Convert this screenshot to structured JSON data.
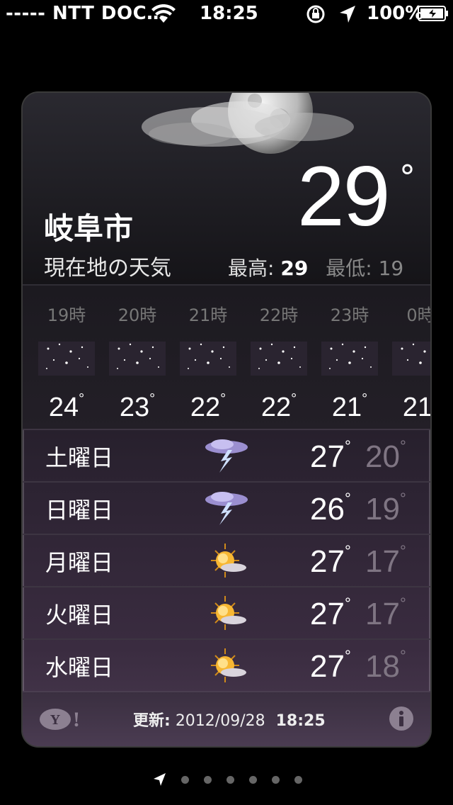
{
  "status_bar": {
    "carrier": "----- NTT DOC…",
    "time": "18:25",
    "battery": "100%"
  },
  "current": {
    "city": "岐阜市",
    "location_label": "現在地の天気",
    "temp": "29",
    "degree": "°",
    "hi_label": "最高:",
    "hi_value": "29",
    "lo_label": "最低:",
    "lo_value": "19",
    "icon": "night-cloudy-moon-icon"
  },
  "hourly": [
    {
      "time": "19時",
      "temp": "24",
      "icon": "clear-night-icon"
    },
    {
      "time": "20時",
      "temp": "23",
      "icon": "clear-night-icon"
    },
    {
      "time": "21時",
      "temp": "22",
      "icon": "clear-night-icon"
    },
    {
      "time": "22時",
      "temp": "22",
      "icon": "clear-night-icon"
    },
    {
      "time": "23時",
      "temp": "21",
      "icon": "clear-night-icon"
    },
    {
      "time": "0時",
      "temp": "21",
      "icon": "clear-night-icon"
    }
  ],
  "daily": [
    {
      "day": "土曜日",
      "hi": "27",
      "lo": "20",
      "icon": "thunderstorm-icon"
    },
    {
      "day": "日曜日",
      "hi": "26",
      "lo": "19",
      "icon": "thunderstorm-icon"
    },
    {
      "day": "月曜日",
      "hi": "27",
      "lo": "17",
      "icon": "partly-sunny-icon"
    },
    {
      "day": "火曜日",
      "hi": "27",
      "lo": "17",
      "icon": "partly-sunny-icon"
    },
    {
      "day": "水曜日",
      "hi": "27",
      "lo": "18",
      "icon": "partly-sunny-icon"
    }
  ],
  "footer": {
    "updated_label": "更新:",
    "updated_date": "2012/09/28",
    "updated_time": "18:25",
    "provider_icon": "yahoo-logo",
    "info_icon": "info-icon"
  },
  "pager": {
    "page_count": 7,
    "current_page": 1
  },
  "colors": {
    "background": "#000000",
    "card_top": "#1b1a1f",
    "card_bottom": "#4a3a50",
    "low_temp": "#7f7583",
    "hour_label": "#777777"
  }
}
